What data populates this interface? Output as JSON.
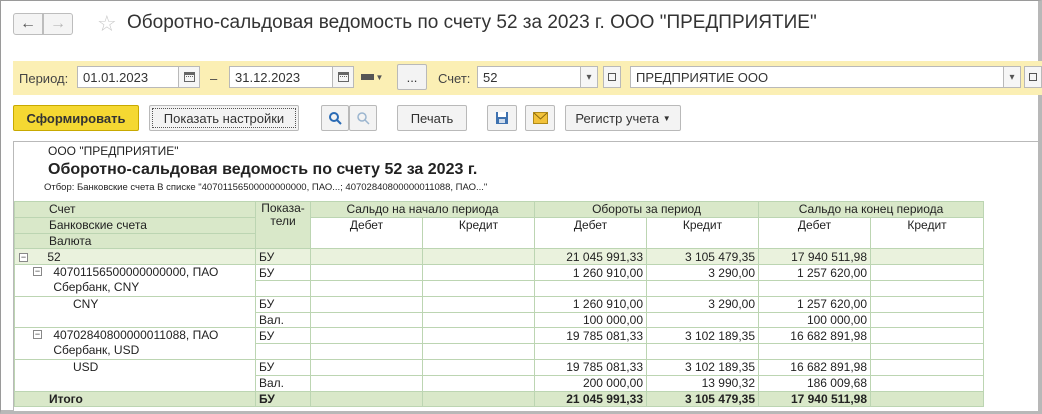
{
  "window": {
    "title": "Оборотно-сальдовая ведомость по счету 52 за 2023 г. ООО \"ПРЕДПРИЯТИЕ\""
  },
  "params": {
    "period_label": "Период:",
    "date_from": "01.01.2023",
    "dash": "–",
    "date_to": "31.12.2023",
    "more_button": "...",
    "account_label": "Счет:",
    "account_value": "52",
    "org_value": "ПРЕДПРИЯТИЕ ООО"
  },
  "toolbar": {
    "generate": "Сформировать",
    "show_settings": "Показать настройки",
    "print": "Печать",
    "register": "Регистр учета"
  },
  "report": {
    "org": "ООО \"ПРЕДПРИЯТИЕ\"",
    "title": "Оборотно-сальдовая ведомость по счету 52 за 2023 г.",
    "filter": "Отбор: Банковские счета В списке \"40701156500000000000, ПАО...; 40702840800000011088, ПАО...\"",
    "headers": {
      "account": "Счет",
      "bank_accounts": "Банковские счета",
      "currency": "Валюта",
      "indicators_1": "Показа-",
      "indicators_2": "тели",
      "opening": "Сальдо на начало периода",
      "turnover": "Обороты за период",
      "closing": "Сальдо на конец периода",
      "debit": "Дебет",
      "credit": "Кредит"
    },
    "rows": {
      "acc52": {
        "name": "52",
        "ind": "БУ",
        "turn_debit": "21 045 991,33",
        "turn_credit": "3 105 479,35",
        "close_debit": "17 940 511,98"
      },
      "cny_acc": {
        "name1": "40701156500000000000, ПАО",
        "name2": "Сбербанк, CNY",
        "ind": "БУ",
        "turn_debit": "1 260 910,00",
        "turn_credit": "3 290,00",
        "close_debit": "1 257 620,00"
      },
      "cny_bu": {
        "name": "CNY",
        "ind": "БУ",
        "turn_debit": "1 260 910,00",
        "turn_credit": "3 290,00",
        "close_debit": "1 257 620,00"
      },
      "cny_val": {
        "ind": "Вал.",
        "turn_debit": "100 000,00",
        "close_debit": "100 000,00"
      },
      "usd_acc": {
        "name1": "40702840800000011088, ПАО",
        "name2": "Сбербанк, USD",
        "ind": "БУ",
        "turn_debit": "19 785 081,33",
        "turn_credit": "3 102 189,35",
        "close_debit": "16 682 891,98"
      },
      "usd_bu": {
        "name": "USD",
        "ind": "БУ",
        "turn_debit": "19 785 081,33",
        "turn_credit": "3 102 189,35",
        "close_debit": "16 682 891,98"
      },
      "usd_val": {
        "ind": "Вал.",
        "turn_debit": "200 000,00",
        "turn_credit": "13 990,32",
        "close_debit": "186 009,68"
      },
      "total": {
        "name": "Итого",
        "ind": "БУ",
        "turn_debit": "21 045 991,33",
        "turn_credit": "3 105 479,35",
        "close_debit": "17 940 511,98"
      }
    }
  },
  "icons": [
    "arrow-left-icon",
    "arrow-right-icon",
    "star-icon",
    "calendar-icon",
    "period-select-icon",
    "dropdown-icon",
    "open-form-icon",
    "search-icon",
    "search-cancel-icon",
    "save-icon",
    "email-icon",
    "tree-collapse-icon"
  ],
  "colors": {
    "params_bg": "#fbefb4",
    "primary_btn": "#f5d832",
    "header_bg": "#d9e8c9",
    "grid_line": "#bcd5b2"
  }
}
